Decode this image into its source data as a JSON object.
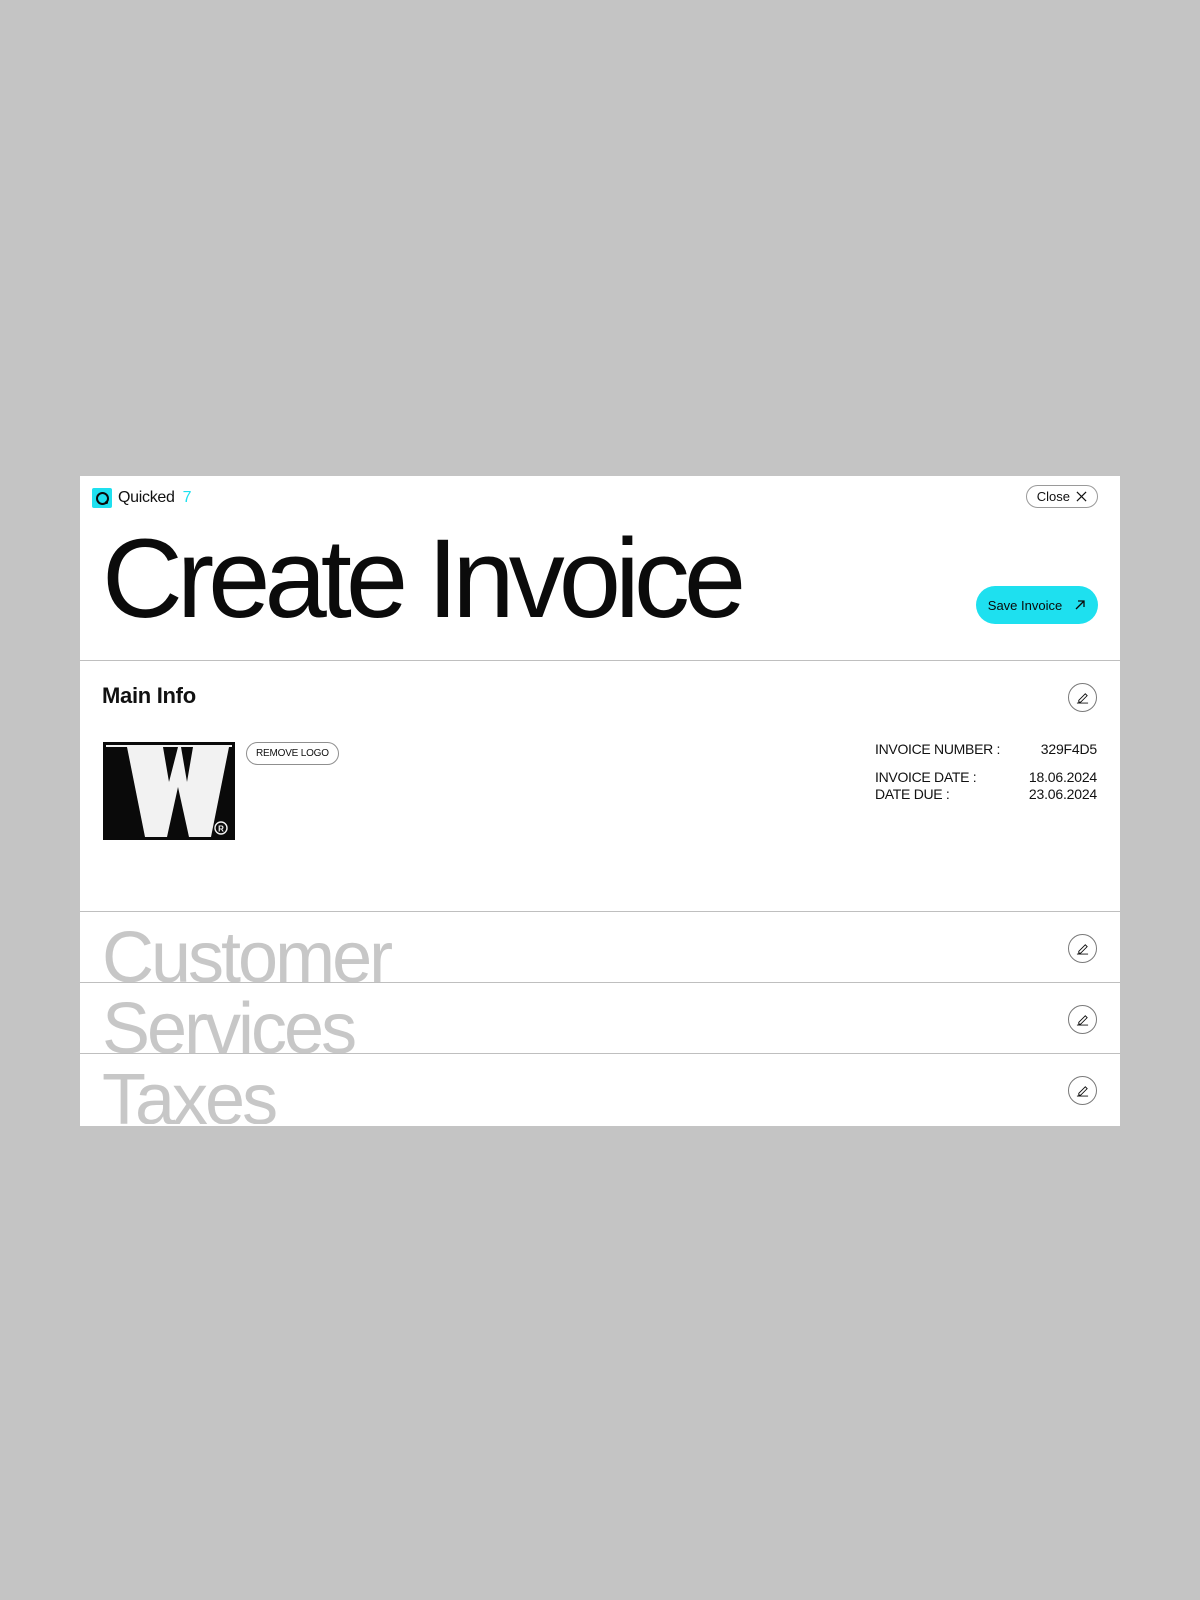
{
  "brand": {
    "name": "Quicked",
    "version": "7"
  },
  "header": {
    "close_label": "Close",
    "title": "Create Invoice",
    "save_label": "Save Invoice"
  },
  "main_info": {
    "heading": "Main Info",
    "remove_logo_label": "REMOVE LOGO",
    "invoice_number_label": "INVOICE NUMBER :",
    "invoice_number": "329F4D5",
    "invoice_date_label": "INVOICE DATE :",
    "invoice_date": "18.06.2024",
    "date_due_label": "DATE DUE :",
    "date_due": "23.06.2024"
  },
  "sections": [
    {
      "title": "Customer"
    },
    {
      "title": "Services"
    },
    {
      "title": "Taxes"
    }
  ],
  "colors": {
    "accent": "#1ee0ef",
    "background": "#c4c4c4",
    "card": "#ffffff",
    "muted_text": "#c7c7c7"
  },
  "icons": {
    "brand": "quicked-logo-icon",
    "close": "close-icon",
    "save": "arrow-up-right-icon",
    "edit": "pencil-icon"
  }
}
